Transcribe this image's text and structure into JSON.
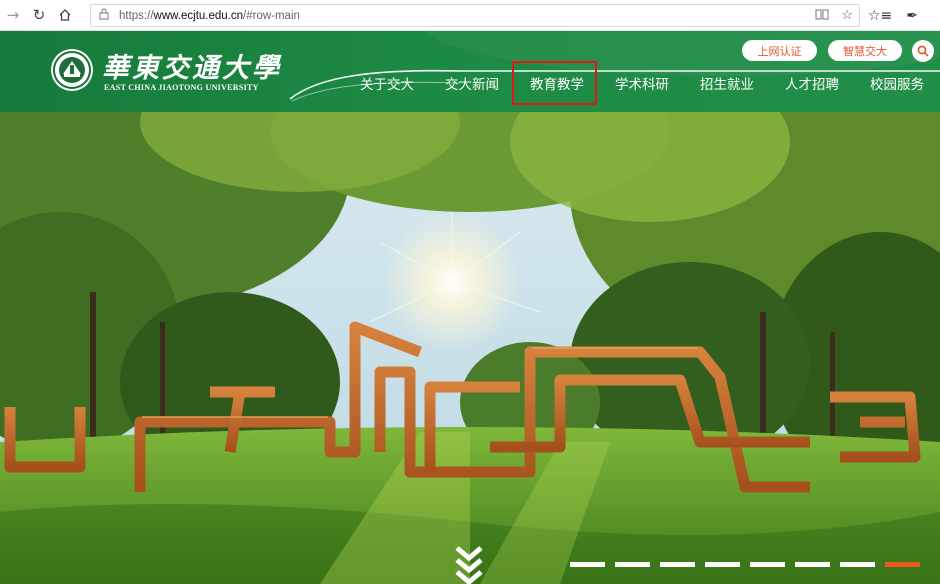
{
  "browser": {
    "url_prefix": "https://",
    "url_host": "www.ecjtu.edu.cn",
    "url_path": "/#row-main",
    "icons": [
      "back-icon",
      "refresh-icon",
      "home-icon",
      "lock-icon",
      "reading-view-icon",
      "favorite-star-icon",
      "favorites-list-icon",
      "pen-icon"
    ]
  },
  "site": {
    "logo_cn": "華東交通大學",
    "logo_en": "EAST CHINA JIAOTONG UNIVERSITY",
    "top_links": {
      "login": "上网认证",
      "smart": "智慧交大"
    },
    "nav": [
      {
        "label": "关于交大"
      },
      {
        "label": "交大新闻"
      },
      {
        "label": "教育教学",
        "highlighted": true
      },
      {
        "label": "学术科研"
      },
      {
        "label": "招生就业"
      },
      {
        "label": "人才招聘"
      },
      {
        "label": "校园服务"
      }
    ]
  },
  "colors": {
    "header_green": "#1d8a44",
    "accent_orange": "#e2552b",
    "highlight_red": "#e8141b",
    "dot_active": "#ea5a1f"
  },
  "hero": {
    "slides_total": 8,
    "active_slide": 8
  }
}
